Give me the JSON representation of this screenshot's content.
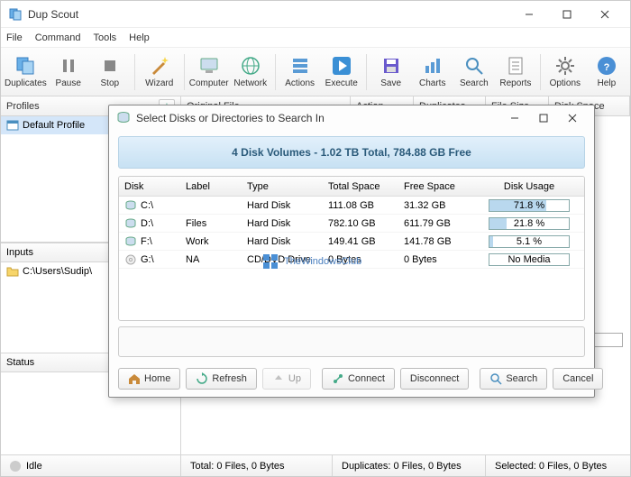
{
  "app": {
    "title": "Dup Scout"
  },
  "menu": [
    "File",
    "Command",
    "Tools",
    "Help"
  ],
  "toolbar": [
    {
      "label": "Duplicates",
      "icon": "copy-icon"
    },
    {
      "label": "Pause",
      "icon": "pause-icon"
    },
    {
      "label": "Stop",
      "icon": "stop-icon"
    },
    {
      "label": "Wizard",
      "icon": "wizard-icon"
    },
    {
      "label": "Computer",
      "icon": "computer-icon"
    },
    {
      "label": "Network",
      "icon": "network-icon"
    },
    {
      "label": "Actions",
      "icon": "actions-icon"
    },
    {
      "label": "Execute",
      "icon": "play-icon"
    },
    {
      "label": "Save",
      "icon": "save-icon"
    },
    {
      "label": "Charts",
      "icon": "charts-icon"
    },
    {
      "label": "Search",
      "icon": "search-icon"
    },
    {
      "label": "Reports",
      "icon": "reports-icon"
    },
    {
      "label": "Options",
      "icon": "gear-icon"
    },
    {
      "label": "Help",
      "icon": "help-icon"
    }
  ],
  "headers": {
    "profiles": "Profiles",
    "original": "Original File",
    "action": "Action",
    "duplicates": "Duplicates",
    "filesize": "File Size",
    "diskspace": "Disk Space",
    "inputs": "Inputs",
    "status": "Status"
  },
  "profiles": [
    "Default Profile"
  ],
  "inputs": [
    "C:\\Users\\Sudip\\"
  ],
  "progress": "0%",
  "statusbar": {
    "state": "Idle",
    "total": "Total: 0 Files, 0 Bytes",
    "duplicates": "Duplicates: 0 Files, 0 Bytes",
    "selected": "Selected: 0 Files, 0 Bytes"
  },
  "dialog": {
    "title": "Select Disks or Directories to Search In",
    "summary": "4 Disk Volumes - 1.02 TB Total, 784.88 GB Free",
    "columns": [
      "Disk",
      "Label",
      "Type",
      "Total Space",
      "Free Space",
      "Disk Usage"
    ],
    "rows": [
      {
        "disk": "C:\\",
        "label": "",
        "type": "Hard Disk",
        "total": "111.08 GB",
        "free": "31.32 GB",
        "usage_pct": 71.8,
        "usage_text": "71.8 %"
      },
      {
        "disk": "D:\\",
        "label": "Files",
        "type": "Hard Disk",
        "total": "782.10 GB",
        "free": "611.79 GB",
        "usage_pct": 21.8,
        "usage_text": "21.8 %"
      },
      {
        "disk": "F:\\",
        "label": "Work",
        "type": "Hard Disk",
        "total": "149.41 GB",
        "free": "141.78 GB",
        "usage_pct": 5.1,
        "usage_text": "5.1 %"
      },
      {
        "disk": "G:\\",
        "label": "NA",
        "type": "CD/DVD Drive",
        "total": "0 Bytes",
        "free": "0 Bytes",
        "usage_pct": 0,
        "usage_text": "No Media"
      }
    ],
    "buttons": {
      "home": "Home",
      "refresh": "Refresh",
      "up": "Up",
      "connect": "Connect",
      "disconnect": "Disconnect",
      "search": "Search",
      "cancel": "Cancel"
    }
  },
  "watermark": "TheWindowsClub"
}
